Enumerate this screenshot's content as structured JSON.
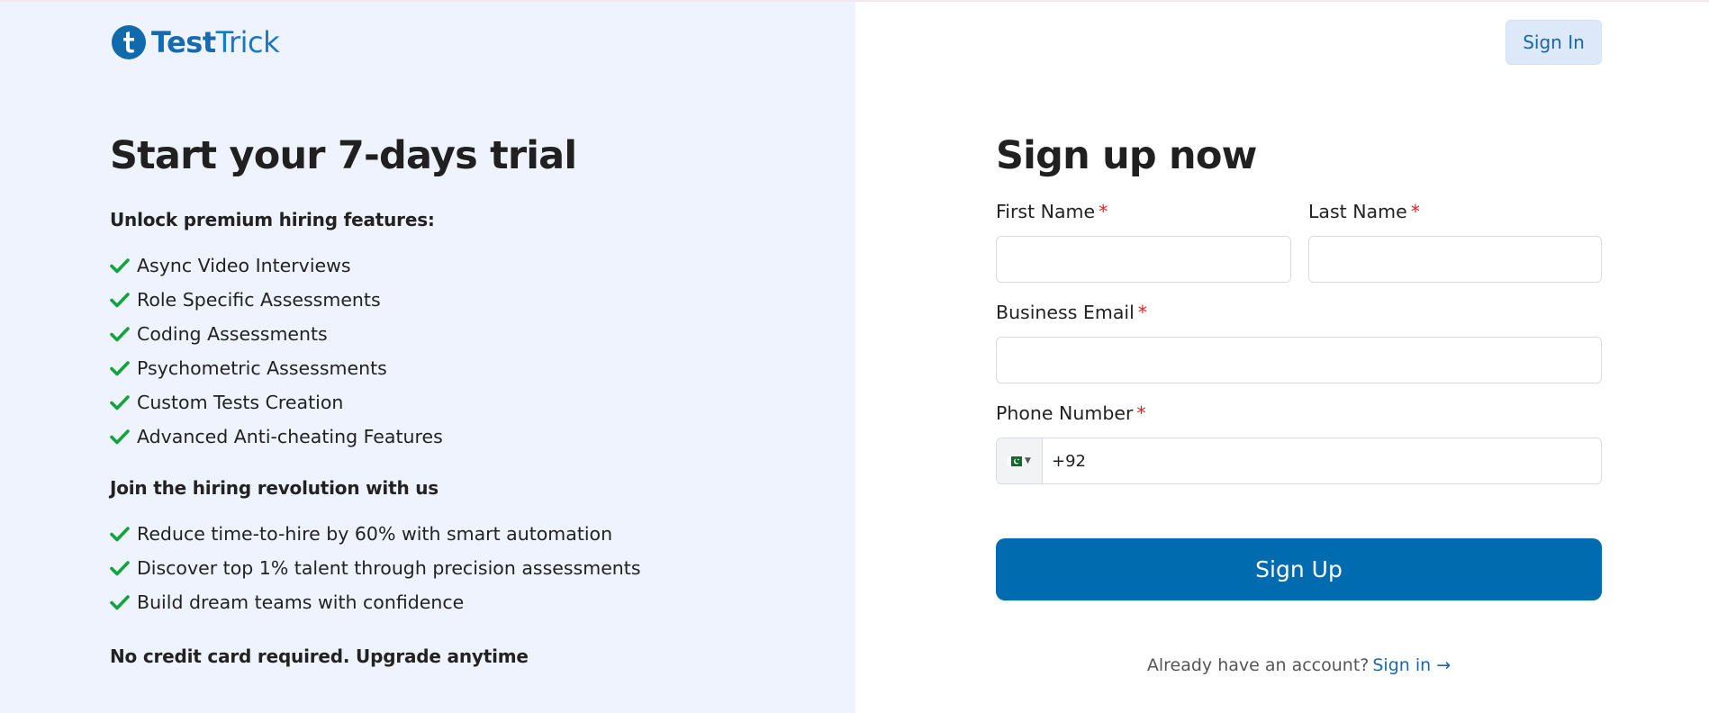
{
  "brand": {
    "name_part1": "Test",
    "name_part2": "Trick",
    "logo_letter": "t",
    "primary_color": "#016bb0"
  },
  "header": {
    "sign_in_label": "Sign In"
  },
  "trial": {
    "title": "Start your 7-days trial",
    "features_heading": "Unlock premium hiring features:",
    "features": [
      "Async Video Interviews",
      "Role Specific Assessments",
      "Coding Assessments",
      "Psychometric Assessments",
      "Custom Tests Creation",
      "Advanced Anti-cheating Features"
    ],
    "revolution_heading": "Join the hiring revolution with us",
    "benefits": [
      "Reduce time-to-hire by 60% with smart automation",
      "Discover top 1% talent through precision assessments",
      "Build dream teams with confidence"
    ],
    "footer_note": "No credit card required. Upgrade anytime",
    "check_icon": "check-icon",
    "check_color": "#12a33c"
  },
  "form": {
    "title": "Sign up now",
    "required_mark": "*",
    "first_name": {
      "label": "First Name",
      "value": "",
      "placeholder": ""
    },
    "last_name": {
      "label": "Last Name",
      "value": "",
      "placeholder": ""
    },
    "email": {
      "label": "Business Email",
      "value": "",
      "placeholder": ""
    },
    "phone": {
      "label": "Phone Number",
      "country_flag": "pakistan-flag",
      "value": "+92"
    },
    "submit_label": "Sign Up",
    "already_text": "Already have an account?",
    "signin_link_label": "Sign in →"
  }
}
